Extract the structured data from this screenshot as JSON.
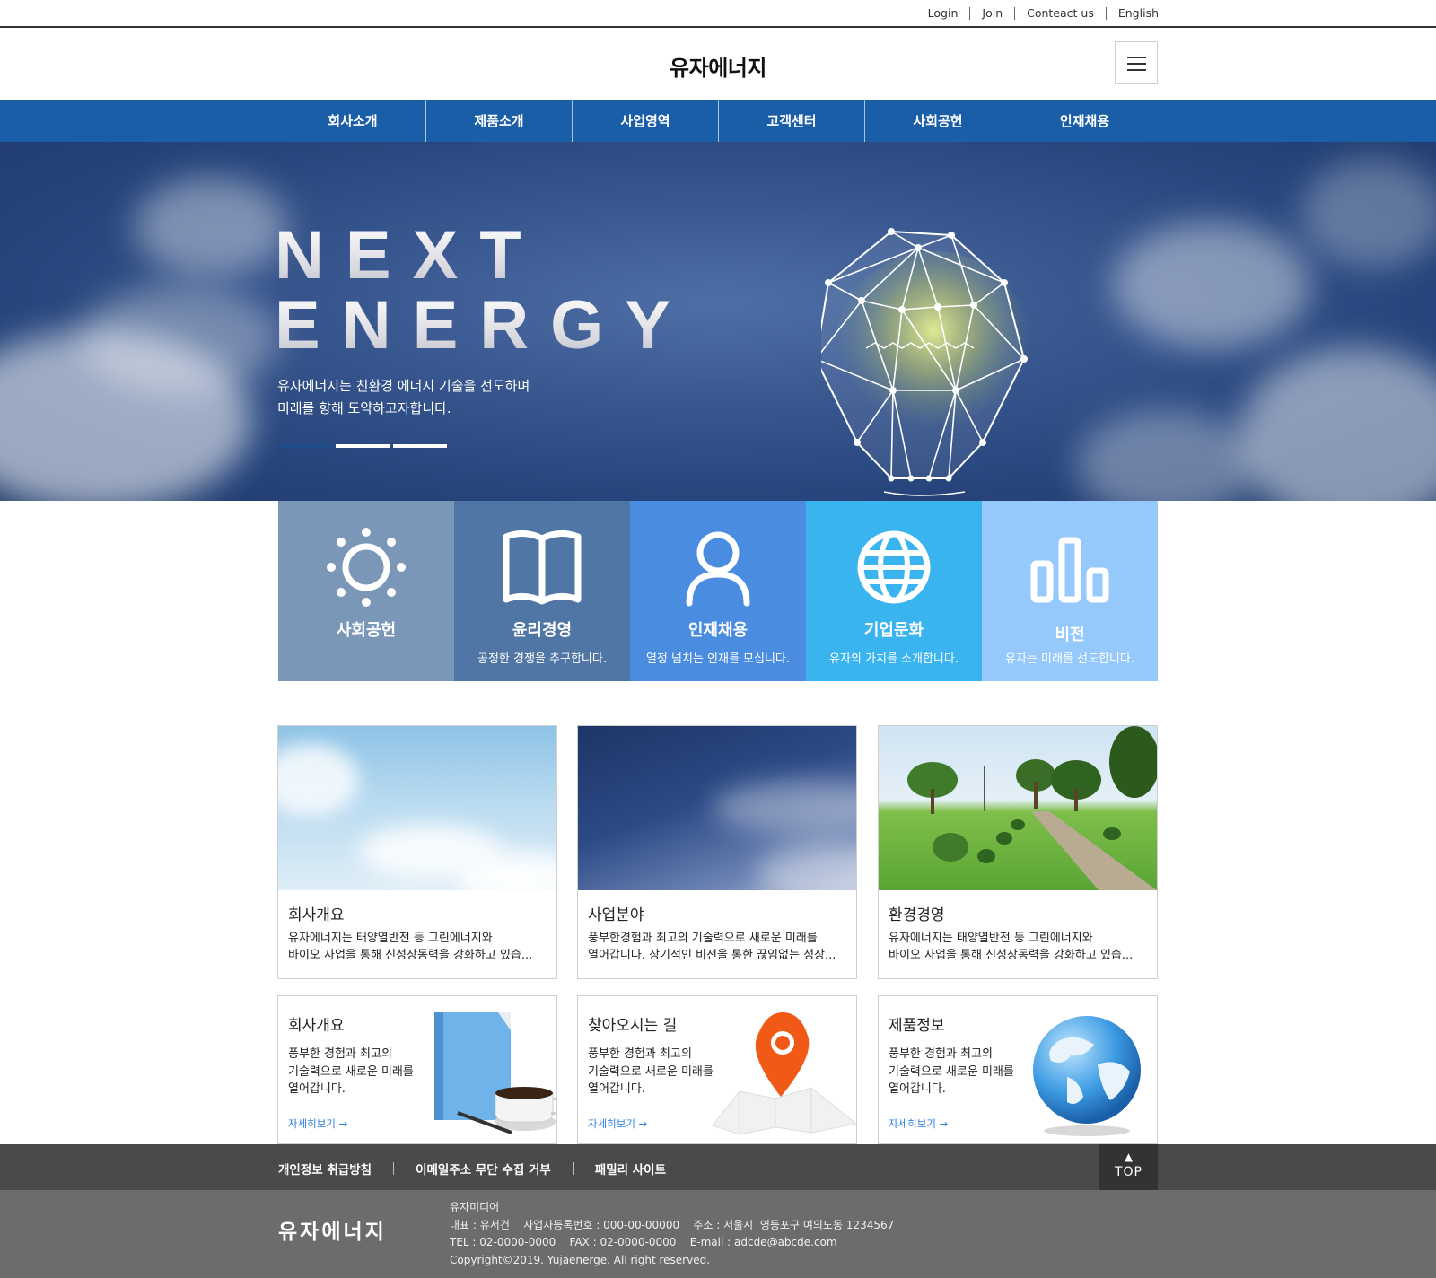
{
  "utility_links": [
    "Login",
    "Join",
    "Conteact us",
    "English"
  ],
  "header": {
    "logo": "유자에너지",
    "menu_icon": "hamburger-icon"
  },
  "nav": [
    "회사소개",
    "제품소개",
    "사업영역",
    "고객센터",
    "사회공헌",
    "인재채용"
  ],
  "hero": {
    "title_line1": "NEXT",
    "title_line2": "ENERGY",
    "sub_line1": "유자에너지는 친환경 에너지 기술을 선도하며",
    "sub_line2": "미래를 향해 도약하고자합니다.",
    "slides": 3,
    "active_slide": 1
  },
  "tiles": [
    {
      "title": "사회공헌",
      "desc": "",
      "icon": "sun-icon",
      "color": "#7a97b8"
    },
    {
      "title": "윤리경영",
      "desc": "공정한 경쟁을 추구합니다.",
      "icon": "book-icon",
      "color": "#4f76a4"
    },
    {
      "title": "인재채용",
      "desc": "열정 넘치는 인재를 모십니다.",
      "icon": "user-icon",
      "color": "#4a8de0"
    },
    {
      "title": "기업문화",
      "desc": "유자의 가치를 소개합니다.",
      "icon": "globe-icon",
      "color": "#3ab4ee"
    },
    {
      "title": "비전",
      "desc": "유자는 미래를 선도합니다.",
      "icon": "bar-chart-icon",
      "color": "#96c9fb"
    }
  ],
  "cards": [
    {
      "title": "회사개요",
      "line1": "유자에너지는 태양열반전 등 그린에너지와",
      "line2": "바이오 사업을 통해 신성장동력을 강화하고 있습...",
      "image": "bright-sky"
    },
    {
      "title": "사업분야",
      "line1": "풍부한경험과 최고의 기술력으로 새로운 미래를",
      "line2": "열어갑니다. 장기적인 비전을 통한 끊임없는 성장...",
      "image": "dark-sky"
    },
    {
      "title": "환경경영",
      "line1": "유자에너지는 태양열반전 등 그린에너지와",
      "line2": "바이오 사업을 통해 신성장동력을 강화하고 있습...",
      "image": "park-path"
    }
  ],
  "boxes": [
    {
      "title": "회사개요",
      "line1": "풍부한 경험과 최고의",
      "line2": "기술력으로 새로운 미래를",
      "line3": "열어갑니다.",
      "more": "자세히보기 →",
      "icon": "notebook-coffee-icon"
    },
    {
      "title": "찾아오시는 길",
      "line1": "풍부한 경험과 최고의",
      "line2": "기술력으로 새로운 미래를",
      "line3": "열어갑니다.",
      "more": "자세히보기 →",
      "icon": "map-pin-icon"
    },
    {
      "title": "제품정보",
      "line1": "풍부한 경험과 최고의",
      "line2": "기술력으로 새로운 미래를",
      "line3": "열어갑니다.",
      "more": "자세히보기 →",
      "icon": "earth-globe-icon"
    }
  ],
  "footer_links": [
    "개인정보 취급방침",
    "이메일주소 무단 수집 거부",
    "패밀리 사이트"
  ],
  "top_button": {
    "arrow": "▲",
    "label": "TOP"
  },
  "footer": {
    "logo": "유자에너지",
    "company": "유자미디어",
    "line1": "대표 : 유서건    사업자등록번호 : 000-00-00000    주소 : 서울시  영등포구 여의도동 1234567",
    "line2": "TEL : 02-0000-0000    FAX : 02-0000-0000    E-mail : adcde@abcde.com",
    "line3": "Copyright©2019. Yujaenerge. All right reserved."
  }
}
